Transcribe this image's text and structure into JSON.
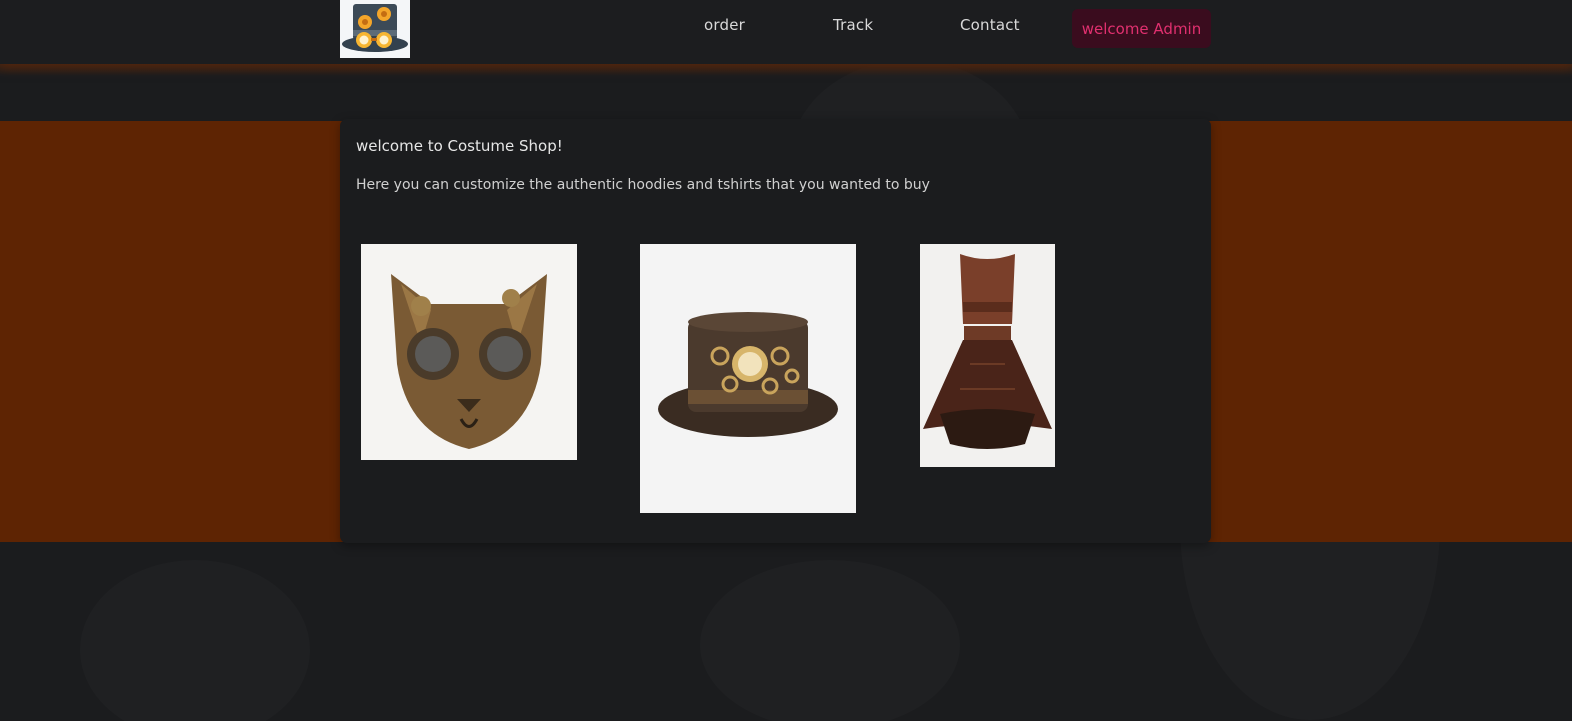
{
  "navbar": {
    "logo_icon": "steampunk-top-hat-logo-icon",
    "links": [
      {
        "label": "order"
      },
      {
        "label": "Track"
      },
      {
        "label": "Contact"
      }
    ],
    "user_button_label": "welcome Admin"
  },
  "main": {
    "title": "welcome to Costume Shop!",
    "subtitle": "Here you can customize the authentic hoodies and tshirts that you wanted to buy",
    "products": [
      {
        "image_icon": "steampunk-cat-mask-image"
      },
      {
        "image_icon": "steampunk-top-hat-image"
      },
      {
        "image_icon": "steampunk-corset-dress-image"
      }
    ]
  },
  "colors": {
    "background": "#1b1c1e",
    "band": "#5e2403",
    "accent_text": "#e0306f",
    "accent_bg": "#3a0c1e"
  }
}
